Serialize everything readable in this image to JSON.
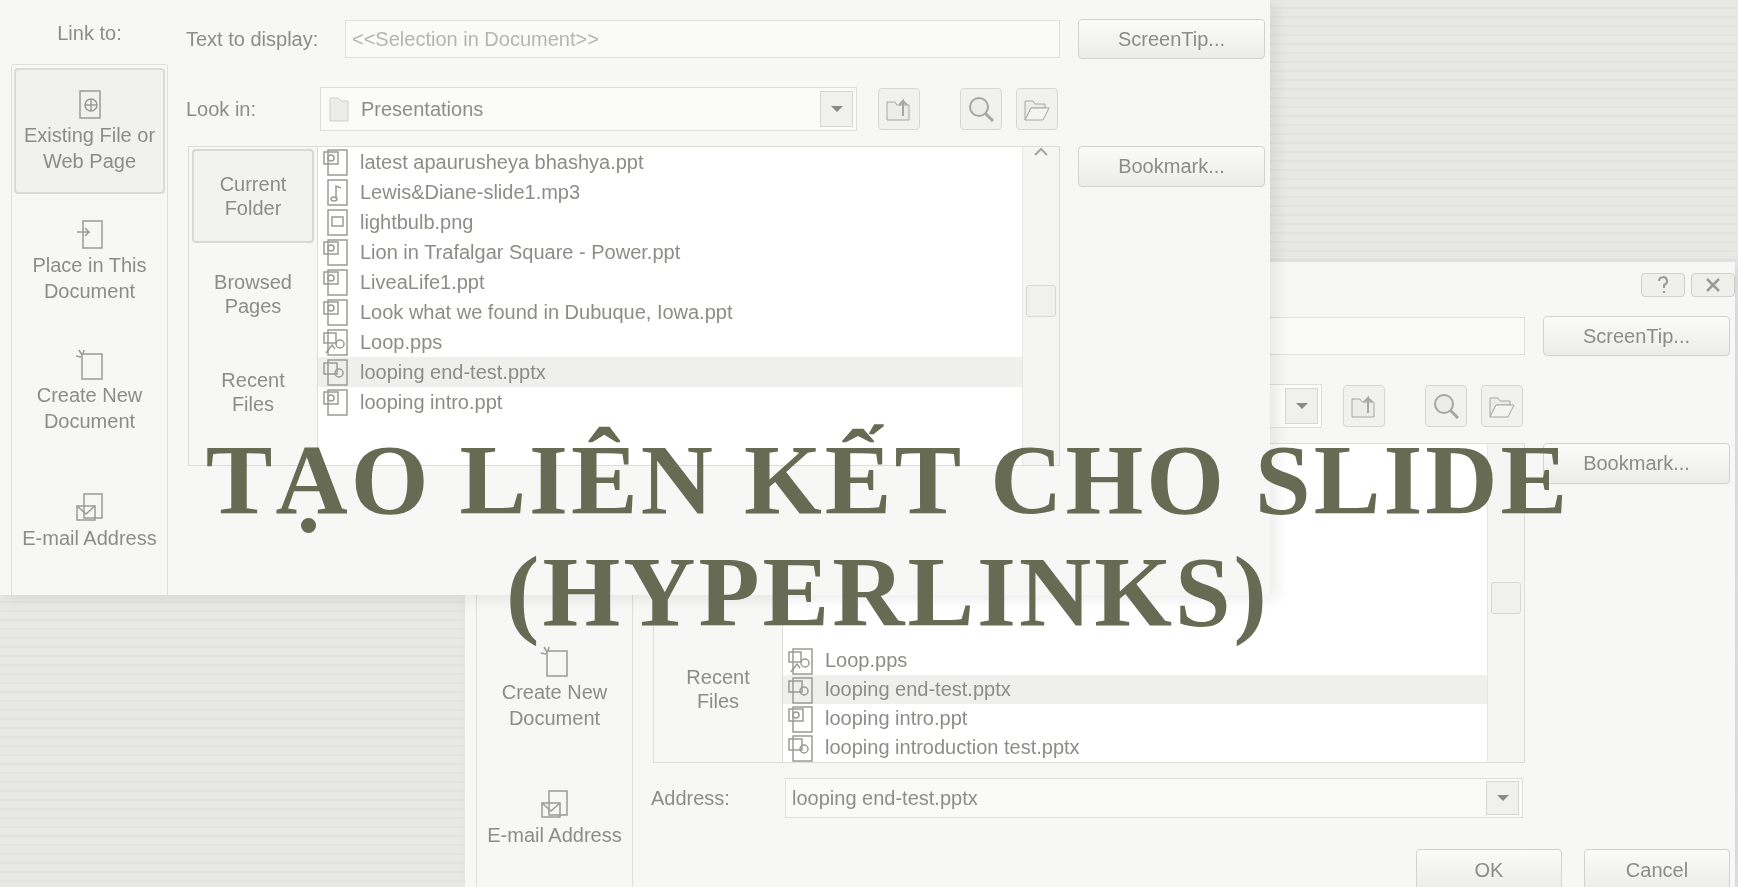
{
  "front_dialog": {
    "link_to_label": "Link to:",
    "link_targets": [
      {
        "label": "Existing File or Web Page",
        "kind": "file",
        "selected": true
      },
      {
        "label": "Place in This Document",
        "kind": "place",
        "selected": false
      },
      {
        "label": "Create New Document",
        "kind": "new",
        "selected": false
      },
      {
        "label": "E-mail Address",
        "kind": "email",
        "selected": false
      }
    ],
    "text_to_display": {
      "label": "Text to display:",
      "placeholder": "<<Selection in Document>>"
    },
    "screentip_button": "ScreenTip...",
    "look_in": {
      "label": "Look in:",
      "value": "Presentations"
    },
    "locations": [
      {
        "label": "Current Folder",
        "selected": true
      },
      {
        "label": "Browsed Pages",
        "selected": false
      },
      {
        "label": "Recent Files",
        "selected": false
      }
    ],
    "files": [
      {
        "name": "latest apaurusheya bhashya.ppt",
        "kind": "presentation",
        "selected": false
      },
      {
        "name": "Lewis&Diane-slide1.mp3",
        "kind": "audio",
        "selected": false
      },
      {
        "name": "lightbulb.png",
        "kind": "image",
        "selected": false
      },
      {
        "name": "Lion in Trafalgar Square - Power.ppt",
        "kind": "presentation",
        "selected": false
      },
      {
        "name": "LiveaLife1.ppt",
        "kind": "presentation",
        "selected": false
      },
      {
        "name": "Look what we found in Dubuque, Iowa.ppt",
        "kind": "presentation",
        "selected": false
      },
      {
        "name": "Loop.pps",
        "kind": "show",
        "selected": false
      },
      {
        "name": "looping end-test.pptx",
        "kind": "presentationx",
        "selected": true
      },
      {
        "name": "looping intro.ppt",
        "kind": "presentation",
        "selected": false
      }
    ],
    "bookmark_button": "Bookmark..."
  },
  "back_dialog": {
    "link_targets": [
      {
        "label": "Create New Document",
        "kind": "new",
        "selected": false
      },
      {
        "label": "E-mail Address",
        "kind": "email",
        "selected": false
      }
    ],
    "screentip_button": "ScreenTip...",
    "locations": [
      {
        "label": "Recent Files",
        "selected": false
      }
    ],
    "files": [
      {
        "name": "Loop.pps",
        "kind": "show",
        "selected": false
      },
      {
        "name": "looping end-test.pptx",
        "kind": "presentationx",
        "selected": true
      },
      {
        "name": "looping intro.ppt",
        "kind": "presentation",
        "selected": false
      },
      {
        "name": "looping introduction test.pptx",
        "kind": "presentationx",
        "selected": false
      }
    ],
    "bookmark_button": "Bookmark...",
    "address": {
      "label": "Address:",
      "value": "looping end-test.pptx"
    },
    "buttons": [
      "OK",
      "Cancel"
    ]
  },
  "title_lines": [
    "TẠO LIÊN KẾT CHO SLIDE",
    "(HYPERLINKS)"
  ]
}
